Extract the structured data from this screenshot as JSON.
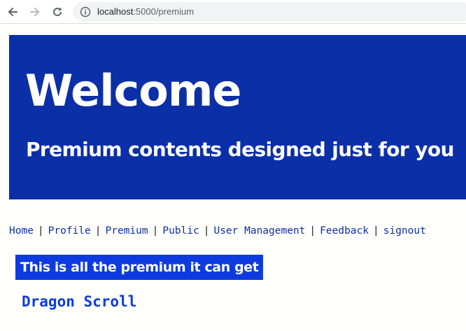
{
  "browser": {
    "url_host": "localhost",
    "url_rest": ":5000/premium"
  },
  "hero": {
    "title": "Welcome",
    "subtitle": "Premium contents designed just for you"
  },
  "nav": {
    "items": [
      {
        "label": "Home"
      },
      {
        "label": "Profile"
      },
      {
        "label": "Premium"
      },
      {
        "label": "Public"
      },
      {
        "label": "User Management"
      },
      {
        "label": "Feedback"
      },
      {
        "label": "signout"
      }
    ],
    "separator": "|"
  },
  "content": {
    "banner": "This is all the premium it can get",
    "item_title": "Dragon Scroll"
  },
  "colors": {
    "hero_bg": "#0b2fa7",
    "banner_bg": "#0d3bdf",
    "link": "#0b2fa7",
    "page_bg": "#fffffb"
  }
}
